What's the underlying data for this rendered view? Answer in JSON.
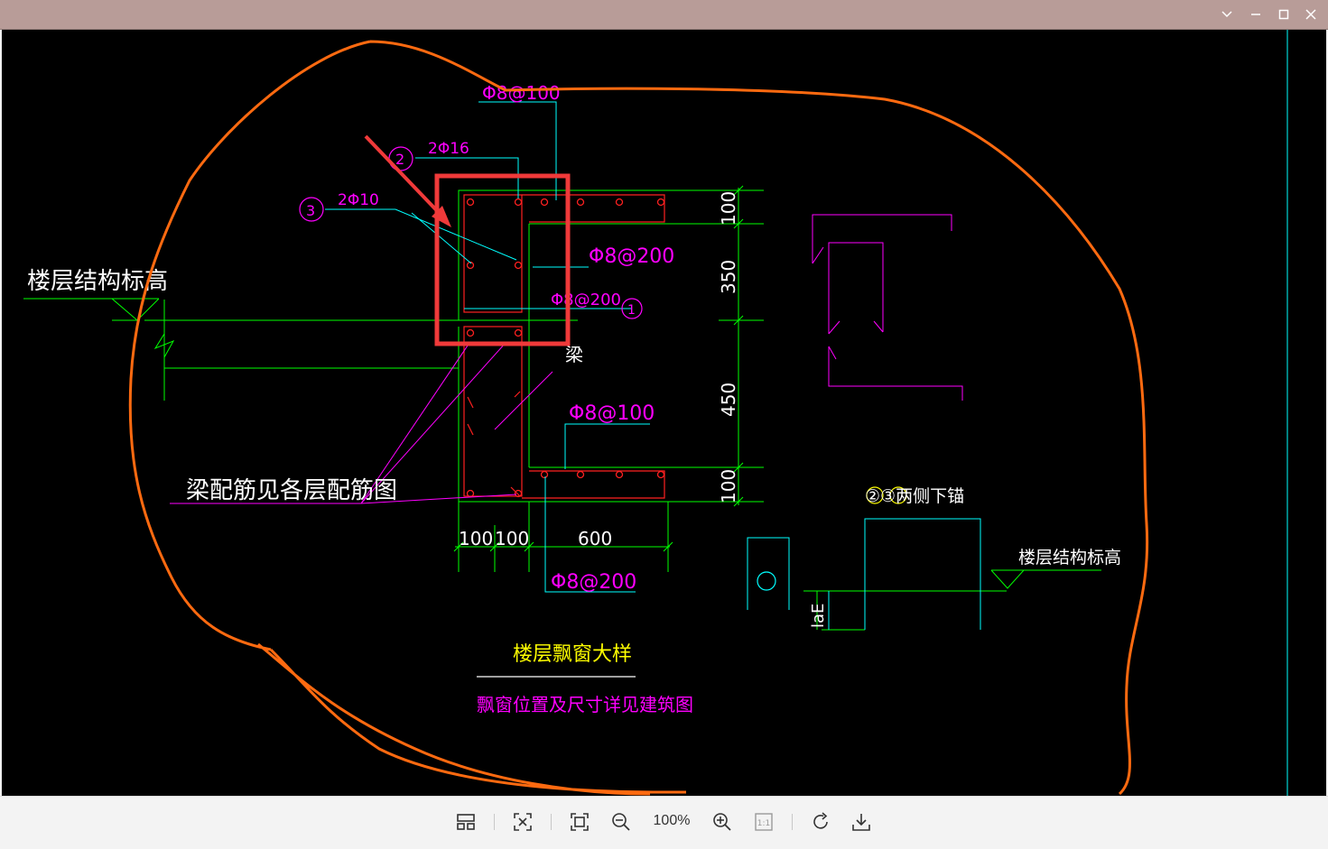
{
  "window": {
    "controls": [
      "collapse",
      "minimize",
      "maximize",
      "close"
    ],
    "titlebar_color": "#b89c98"
  },
  "drawing": {
    "title": "楼层飘窗大样",
    "subtitle": "飘窗位置及尺寸详见建筑图",
    "floor_level_label_left": "楼层结构标高",
    "floor_level_label_right": "楼层结构标高",
    "beam_label": "梁",
    "beam_note": "梁配筋见各层配筋图",
    "anchor_note": "②③两侧下锚",
    "lae_label": "laE",
    "rebar_top_stirrup": "Φ8@100",
    "rebar_2": "2Φ16",
    "rebar_3": "2Φ10",
    "rebar_top_slab": "Φ8@200",
    "rebar_middle": "Φ8@200",
    "rebar_bottom_slab": "Φ8@100",
    "rebar_bottom_dim": "Φ8@200",
    "circle_1": "1",
    "circle_2": "2",
    "circle_3": "3",
    "dim_vertical": [
      "100",
      "350",
      "450",
      "100"
    ],
    "dim_horizontal": [
      "100",
      "100",
      "600"
    ],
    "colors": {
      "background": "#000000",
      "annotation": "#ff00ff",
      "dimension": "#00ff00",
      "concrete": "#ff2020",
      "leader": "#00ffff",
      "title": "#ffff00",
      "markup_circle": "#ff6a10",
      "markup_box": "#f03a3a"
    }
  },
  "toolbar": {
    "zoom_level": "100%",
    "buttons": [
      "layout-icon",
      "fit-icon",
      "fullscreen-icon",
      "zoom-out-icon",
      "zoom-in-icon",
      "actual-size-icon",
      "rotate-icon",
      "download-icon"
    ]
  }
}
